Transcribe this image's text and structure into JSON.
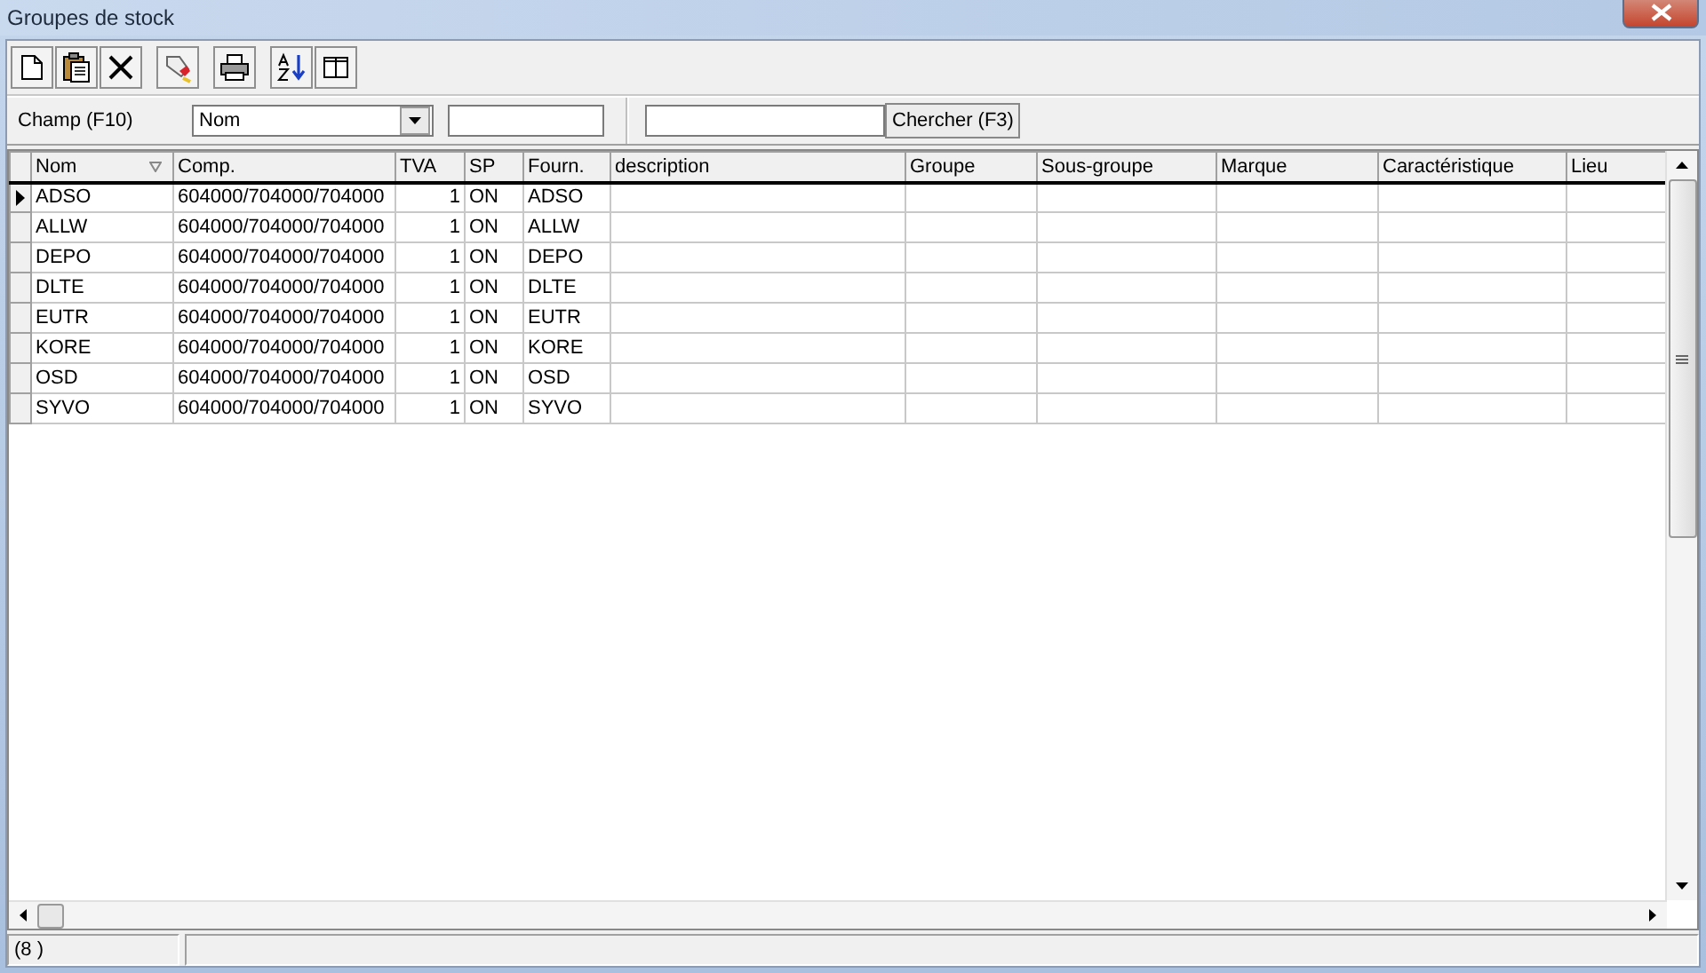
{
  "window": {
    "title": "Groupes de stock"
  },
  "search": {
    "field_label": "Champ (F10)",
    "field_choice": "Nom",
    "button": "Chercher (F3)"
  },
  "table": {
    "columns": [
      {
        "label": "Nom",
        "sorted": true
      },
      {
        "label": "Comp.",
        "sorted": false
      },
      {
        "label": "TVA",
        "sorted": false
      },
      {
        "label": "SP",
        "sorted": false
      },
      {
        "label": "Fourn.",
        "sorted": false
      },
      {
        "label": "description",
        "sorted": false
      },
      {
        "label": "Groupe",
        "sorted": false
      },
      {
        "label": "Sous-groupe",
        "sorted": false
      },
      {
        "label": "Marque",
        "sorted": false
      },
      {
        "label": "Caractéristique",
        "sorted": false
      },
      {
        "label": "Lieu",
        "sorted": false
      }
    ],
    "rows": [
      {
        "selected": true,
        "cells": [
          "ADSO",
          "604000/704000/704000",
          "1",
          "ON",
          "ADSO"
        ]
      },
      {
        "selected": false,
        "cells": [
          "ALLW",
          "604000/704000/704000",
          "1",
          "ON",
          "ALLW"
        ]
      },
      {
        "selected": false,
        "cells": [
          "DEPO",
          "604000/704000/704000",
          "1",
          "ON",
          "DEPO"
        ]
      },
      {
        "selected": false,
        "cells": [
          "DLTE",
          "604000/704000/704000",
          "1",
          "ON",
          "DLTE"
        ]
      },
      {
        "selected": false,
        "cells": [
          "EUTR",
          "604000/704000/704000",
          "1",
          "ON",
          "EUTR"
        ]
      },
      {
        "selected": false,
        "cells": [
          "KORE",
          "604000/704000/704000",
          "1",
          "ON",
          "KORE"
        ]
      },
      {
        "selected": false,
        "cells": [
          "OSD",
          "604000/704000/704000",
          "1",
          "ON",
          "OSD"
        ]
      },
      {
        "selected": false,
        "cells": [
          "SYVO",
          "604000/704000/704000",
          "1",
          "ON",
          "SYVO"
        ]
      }
    ]
  },
  "status_bar": {
    "count": "(8 )"
  }
}
